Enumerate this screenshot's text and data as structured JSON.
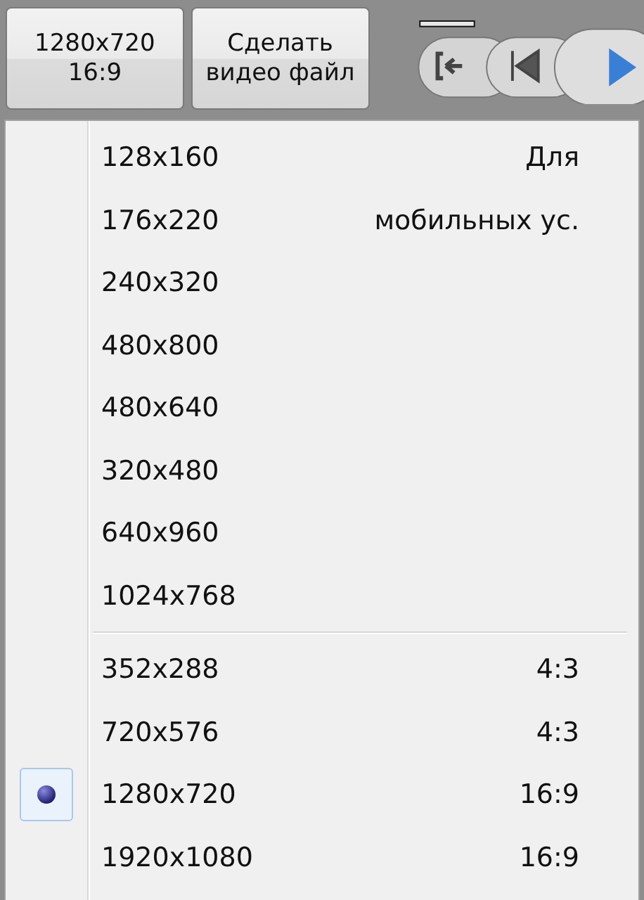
{
  "toolbar": {
    "buttons": [
      {
        "lines": [
          "1280x720",
          "16:9"
        ]
      },
      {
        "lines": [
          "Сделать",
          "видео файл"
        ]
      }
    ]
  },
  "menu": {
    "groups": [
      {
        "items": [
          {
            "label": "128x160",
            "note": "Для",
            "selected": false
          },
          {
            "label": "176x220",
            "note": "мобильных ус.",
            "selected": false
          },
          {
            "label": "240x320",
            "selected": false
          },
          {
            "label": "480x800",
            "selected": false
          },
          {
            "label": "480x640",
            "selected": false
          },
          {
            "label": "320x480",
            "selected": false
          },
          {
            "label": "640x960",
            "selected": false
          },
          {
            "label": "1024x768",
            "selected": false
          }
        ]
      },
      {
        "items": [
          {
            "label": "352x288",
            "note": "4:3",
            "selected": false
          },
          {
            "label": "720x576",
            "note": "4:3",
            "selected": false
          },
          {
            "label": "1280x720",
            "note": "16:9",
            "selected": true
          },
          {
            "label": "1920x1080",
            "note": "16:9",
            "selected": false
          }
        ]
      }
    ]
  }
}
